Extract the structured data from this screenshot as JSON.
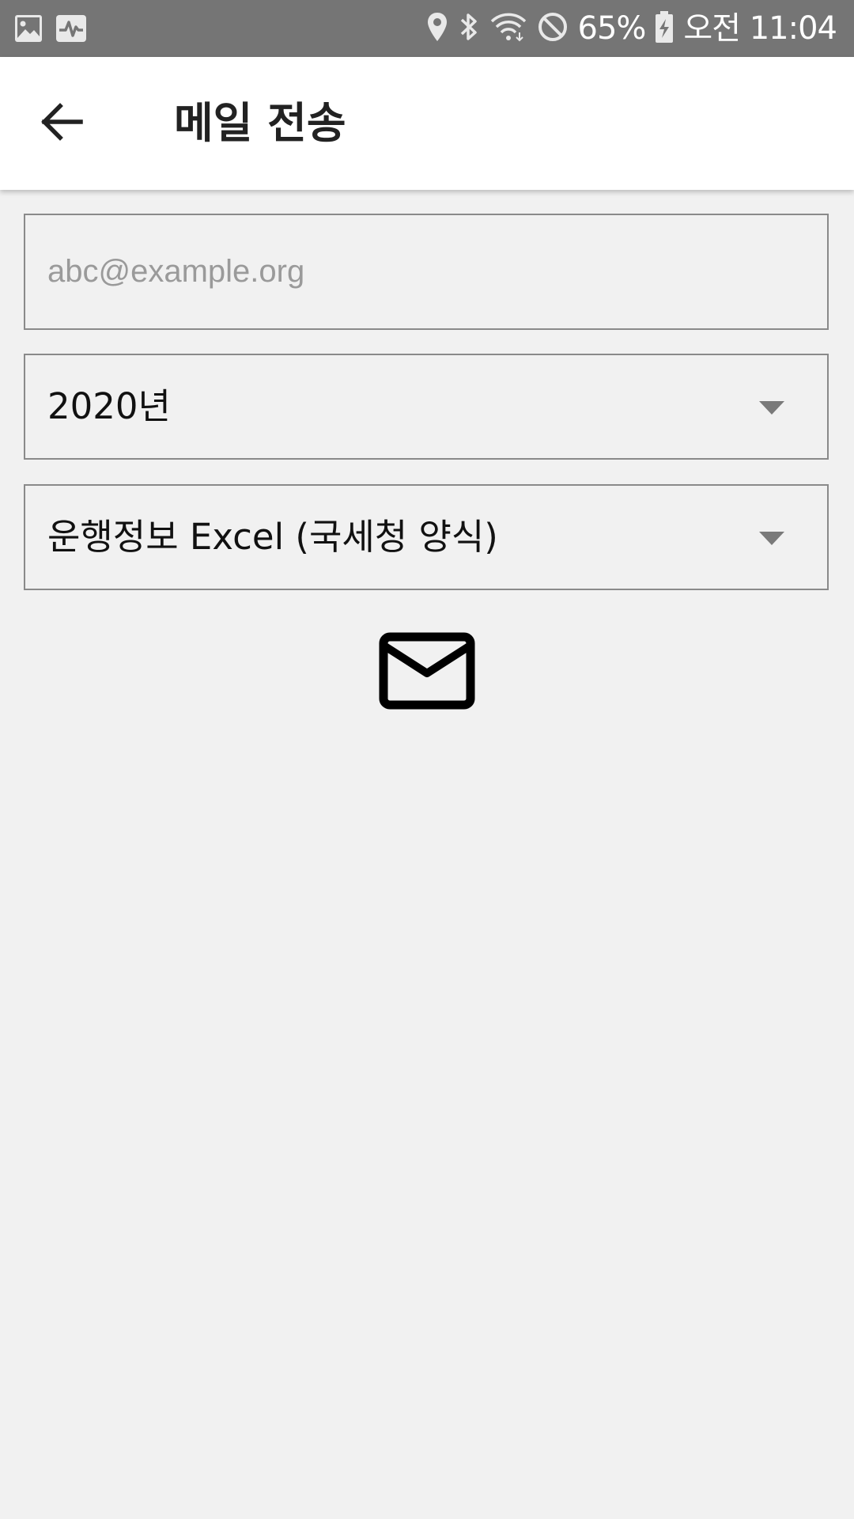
{
  "status_bar": {
    "battery": "65%",
    "time": "오전 11:04",
    "left_icons": [
      "image-icon",
      "activity-icon"
    ],
    "right_icons": [
      "location-icon",
      "bluetooth-icon",
      "wifi-icon",
      "do-not-disturb-icon",
      "battery-charging-icon"
    ]
  },
  "app_bar": {
    "title": "메일 전송",
    "back_icon": "arrow-back-icon"
  },
  "form": {
    "email_placeholder": "abc@example.org",
    "email_value": "",
    "year_selected": "2020년",
    "type_selected": "운행정보 Excel (국세청 양식)",
    "send_icon": "mail-icon"
  },
  "colors": {
    "status_bar": "#757575",
    "app_bar": "#ffffff",
    "background": "#f1f1f1",
    "field_border": "#8a8a8a",
    "placeholder": "#9a9a9a"
  }
}
